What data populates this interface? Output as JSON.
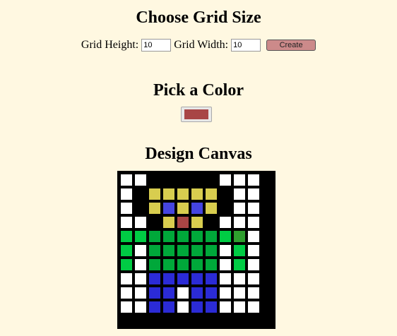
{
  "size_section": {
    "title": "Choose Grid Size",
    "height_label": "Grid Height:",
    "height_value": "10",
    "width_label": "Grid Width:",
    "width_value": "10",
    "create_label": "Create"
  },
  "color_section": {
    "title": "Pick a Color",
    "selected_color": "#a84545"
  },
  "canvas_section": {
    "title": "Design Canvas",
    "rows": 10,
    "cols": 10,
    "palette": {
      "W": "#ffffff",
      "K": "#000000",
      "Y": "#d8cd4f",
      "B": "#4545e0",
      "R": "#a84545",
      "G": "#00cc44",
      "D": "#00a83a",
      "L": "#2e9e2e",
      "N": "#2b2bd6"
    },
    "cells": [
      "WWKKKKKWWW",
      "WKYYYYYKWW",
      "WKYBYBYKWW",
      "WWKYRYKWWW",
      "GGDDDDDGLW",
      "GWDDDDDWGW",
      "GWDDDDDWGW",
      "WWNNNNNWWW",
      "WWNNWNNWWW",
      "WWNNWNNWWW"
    ]
  }
}
